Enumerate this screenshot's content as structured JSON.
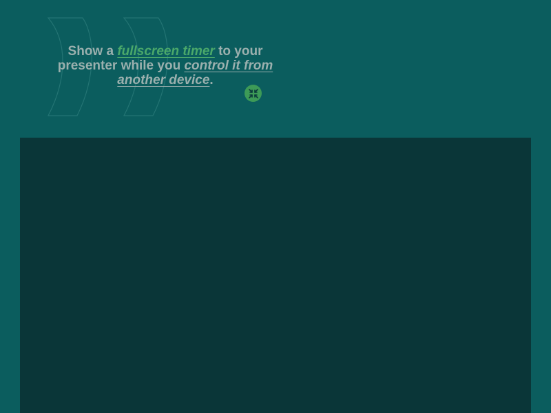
{
  "hero": {
    "part1": "Show a ",
    "link1": "fullscreen timer",
    "part2": " to your presenter while you ",
    "link2": "control it from another device",
    "part3": "."
  },
  "icons": {
    "deco": "quote-marks-icon",
    "minimize": "collapse-arrows-icon"
  },
  "colors": {
    "background": "#0b5d5e",
    "panel": "#0a3638",
    "text": "#9bb0ae",
    "accent": "#4aa86a",
    "button": "#3d9a57"
  }
}
